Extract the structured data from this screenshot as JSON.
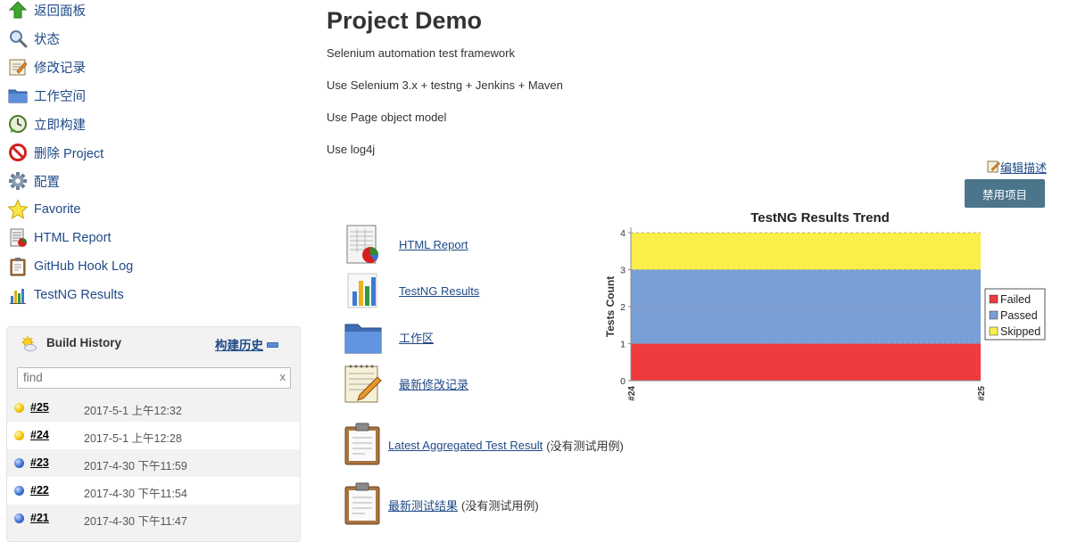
{
  "sidebar": {
    "items": [
      {
        "label": "返回面板",
        "icon": "up-arrow-icon"
      },
      {
        "label": "状态",
        "icon": "search-icon"
      },
      {
        "label": "修改记录",
        "icon": "notepad-icon"
      },
      {
        "label": "工作空间",
        "icon": "folder-icon"
      },
      {
        "label": "立即构建",
        "icon": "clock-build-icon"
      },
      {
        "label": "删除 Project",
        "icon": "no-entry-icon"
      },
      {
        "label": "配置",
        "icon": "gear-icon"
      },
      {
        "label": "Favorite",
        "icon": "star-icon"
      },
      {
        "label": "HTML Report",
        "icon": "html-report-icon"
      },
      {
        "label": "GitHub Hook Log",
        "icon": "clipboard-icon"
      },
      {
        "label": "TestNG Results",
        "icon": "bar-chart-icon"
      }
    ]
  },
  "build_history": {
    "title": "Build History",
    "trend_link": "构建历史",
    "search": {
      "value": "",
      "placeholder": "find",
      "clear": "x"
    },
    "builds": [
      {
        "number": "#25",
        "date": "2017-5-1 上午12:32",
        "status": "yellow"
      },
      {
        "number": "#24",
        "date": "2017-5-1 上午12:28",
        "status": "yellow"
      },
      {
        "number": "#23",
        "date": "2017-4-30 下午11:59",
        "status": "blue"
      },
      {
        "number": "#22",
        "date": "2017-4-30 下午11:54",
        "status": "blue"
      },
      {
        "number": "#21",
        "date": "2017-4-30 下午11:47",
        "status": "blue"
      }
    ]
  },
  "main": {
    "title": "Project Demo",
    "description": [
      "Selenium automation test framework",
      "Use Selenium 3.x + testng + Jenkins + Maven",
      "Use Page object model",
      "Use log4j"
    ],
    "edit_description": "编辑描述",
    "disable_button": "禁用项目",
    "links": [
      {
        "label": "HTML Report",
        "icon": "html-report-icon"
      },
      {
        "label": "TestNG Results",
        "icon": "bar-chart-icon"
      },
      {
        "label": "工作区",
        "icon": "folder-icon"
      },
      {
        "label": "最新修改记录",
        "icon": "notepad-icon"
      }
    ],
    "reports": [
      {
        "label": "Latest Aggregated Test Result",
        "note": "(没有测试用例)"
      },
      {
        "label": "最新测试结果",
        "note": "(没有测试用例)"
      }
    ]
  },
  "colors": {
    "failed": "#ef3a3f",
    "passed": "#7a9fd6",
    "skipped": "#fbee4b",
    "button": "#4b758b",
    "link": "#204a87"
  },
  "chart_data": {
    "type": "area",
    "title": "TestNG Results Trend",
    "ylabel": "Tests Count",
    "xlabel": "",
    "categories": [
      "#24",
      "#25"
    ],
    "ylim": [
      0,
      4
    ],
    "yticks": [
      0,
      1,
      2,
      3,
      4
    ],
    "stacked": true,
    "grid": true,
    "legend_position": "right",
    "series": [
      {
        "name": "Failed",
        "values": [
          1,
          1
        ],
        "color": "#ef3a3f"
      },
      {
        "name": "Passed",
        "values": [
          2,
          2
        ],
        "color": "#7a9fd6"
      },
      {
        "name": "Skipped",
        "values": [
          1,
          1
        ],
        "color": "#fbee4b"
      }
    ]
  }
}
